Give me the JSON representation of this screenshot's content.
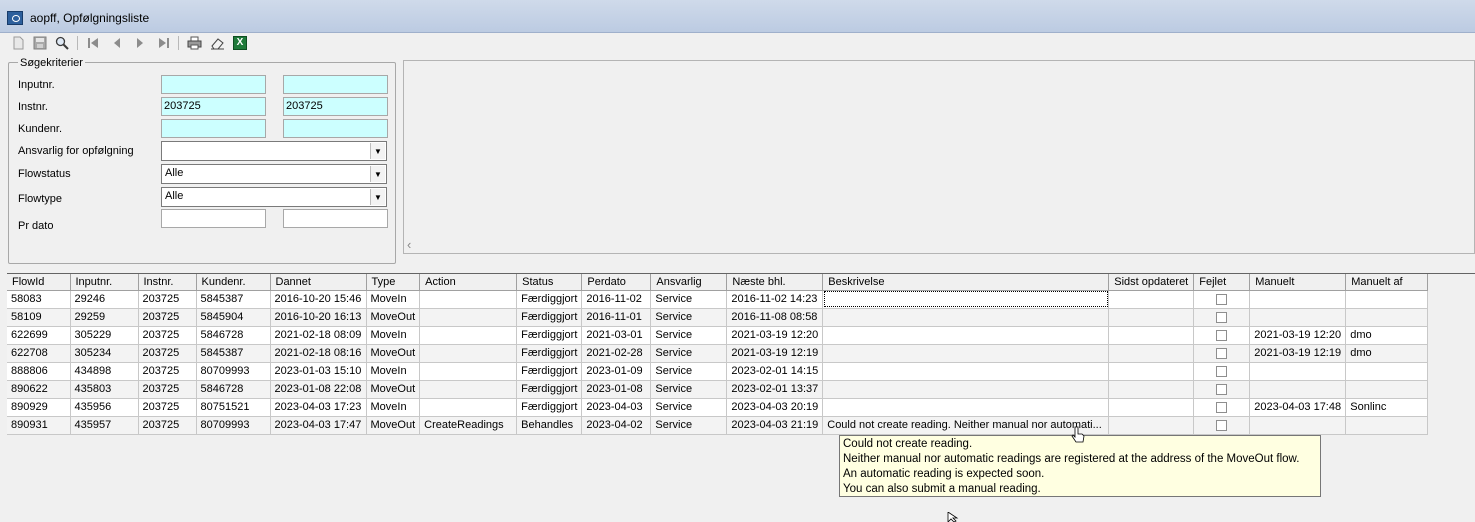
{
  "window": {
    "title": "aopff, Opfølgningsliste"
  },
  "toolbar": {
    "icons": [
      "new-icon",
      "save-icon",
      "search-icon",
      "first-record-icon",
      "previous-record-icon",
      "next-record-icon",
      "last-record-icon",
      "print-icon",
      "clear-icon",
      "excel-icon"
    ],
    "excel_letter": "X"
  },
  "search": {
    "legend": "Søgekriterier",
    "inputnr_label": "Inputnr.",
    "inputnr_from": "",
    "inputnr_to": "",
    "instnr_label": "Instnr.",
    "instnr_from": "203725",
    "instnr_to": "203725",
    "kundenr_label": "Kundenr.",
    "kundenr_from": "",
    "kundenr_to": "",
    "ansvarlig_label": "Ansvarlig for opfølgning",
    "ansvarlig_value": "",
    "flowstatus_label": "Flowstatus",
    "flowstatus_value": "Alle",
    "flowtype_label": "Flowtype",
    "flowtype_value": "Alle",
    "prdato_label": "Pr dato",
    "prdato_from": "",
    "prdato_to": ""
  },
  "grid": {
    "columns": [
      "FlowId",
      "Inputnr.",
      "Instnr.",
      "Kundenr.",
      "Dannet",
      "Type",
      "Action",
      "Status",
      "Perdato",
      "Ansvarlig",
      "Næste bhl.",
      "Beskrivelse",
      "Sidst opdateret",
      "Fejlet",
      "Manuelt",
      "Manuelt af"
    ],
    "rows": [
      {
        "flowid": "58083",
        "inputnr": "29246",
        "instnr": "203725",
        "kundenr": "5845387",
        "dannet": "2016-10-20 15:46",
        "type": "MoveIn",
        "action": "",
        "status": "Færdiggjort",
        "perdato": "2016-11-02",
        "ansvarlig": "Service",
        "naeste": "2016-11-02 14:23",
        "beskrivelse": "",
        "sidst": "",
        "fejlet": false,
        "manuelt": "",
        "manuelt_af": ""
      },
      {
        "flowid": "58109",
        "inputnr": "29259",
        "instnr": "203725",
        "kundenr": "5845904",
        "dannet": "2016-10-20 16:13",
        "type": "MoveOut",
        "action": "",
        "status": "Færdiggjort",
        "perdato": "2016-11-01",
        "ansvarlig": "Service",
        "naeste": "2016-11-08 08:58",
        "beskrivelse": "",
        "sidst": "",
        "fejlet": false,
        "manuelt": "",
        "manuelt_af": ""
      },
      {
        "flowid": "622699",
        "inputnr": "305229",
        "instnr": "203725",
        "kundenr": "5846728",
        "dannet": "2021-02-18 08:09",
        "type": "MoveIn",
        "action": "",
        "status": "Færdiggjort",
        "perdato": "2021-03-01",
        "ansvarlig": "Service",
        "naeste": "2021-03-19 12:20",
        "beskrivelse": "",
        "sidst": "",
        "fejlet": false,
        "manuelt": "2021-03-19 12:20",
        "manuelt_af": "dmo"
      },
      {
        "flowid": "622708",
        "inputnr": "305234",
        "instnr": "203725",
        "kundenr": "5845387",
        "dannet": "2021-02-18 08:16",
        "type": "MoveOut",
        "action": "",
        "status": "Færdiggjort",
        "perdato": "2021-02-28",
        "ansvarlig": "Service",
        "naeste": "2021-03-19 12:19",
        "beskrivelse": "",
        "sidst": "",
        "fejlet": false,
        "manuelt": "2021-03-19 12:19",
        "manuelt_af": "dmo"
      },
      {
        "flowid": "888806",
        "inputnr": "434898",
        "instnr": "203725",
        "kundenr": "80709993",
        "dannet": "2023-01-03 15:10",
        "type": "MoveIn",
        "action": "",
        "status": "Færdiggjort",
        "perdato": "2023-01-09",
        "ansvarlig": "Service",
        "naeste": "2023-02-01 14:15",
        "beskrivelse": "",
        "sidst": "",
        "fejlet": false,
        "manuelt": "",
        "manuelt_af": ""
      },
      {
        "flowid": "890622",
        "inputnr": "435803",
        "instnr": "203725",
        "kundenr": "5846728",
        "dannet": "2023-01-08 22:08",
        "type": "MoveOut",
        "action": "",
        "status": "Færdiggjort",
        "perdato": "2023-01-08",
        "ansvarlig": "Service",
        "naeste": "2023-02-01 13:37",
        "beskrivelse": "",
        "sidst": "",
        "fejlet": false,
        "manuelt": "",
        "manuelt_af": ""
      },
      {
        "flowid": "890929",
        "inputnr": "435956",
        "instnr": "203725",
        "kundenr": "80751521",
        "dannet": "2023-04-03 17:23",
        "type": "MoveIn",
        "action": "",
        "status": "Færdiggjort",
        "perdato": "2023-04-03",
        "ansvarlig": "Service",
        "naeste": "2023-04-03 20:19",
        "beskrivelse": "",
        "sidst": "",
        "fejlet": false,
        "manuelt": "2023-04-03 17:48",
        "manuelt_af": "Sonlinc"
      },
      {
        "flowid": "890931",
        "inputnr": "435957",
        "instnr": "203725",
        "kundenr": "80709993",
        "dannet": "2023-04-03 17:47",
        "type": "MoveOut",
        "action": "CreateReadings",
        "status": "Behandles",
        "perdato": "2023-04-02",
        "ansvarlig": "Service",
        "naeste": "2023-04-03 21:19",
        "beskrivelse": "Could not create reading. Neither manual nor automati...",
        "sidst": "",
        "fejlet": false,
        "manuelt": "",
        "manuelt_af": ""
      }
    ]
  },
  "tooltip": {
    "lines": [
      "Could not create reading.",
      "Neither manual nor automatic readings are registered at the address of the MoveOut flow.",
      "An automatic reading is expected soon.",
      "You can also submit a manual reading."
    ]
  }
}
